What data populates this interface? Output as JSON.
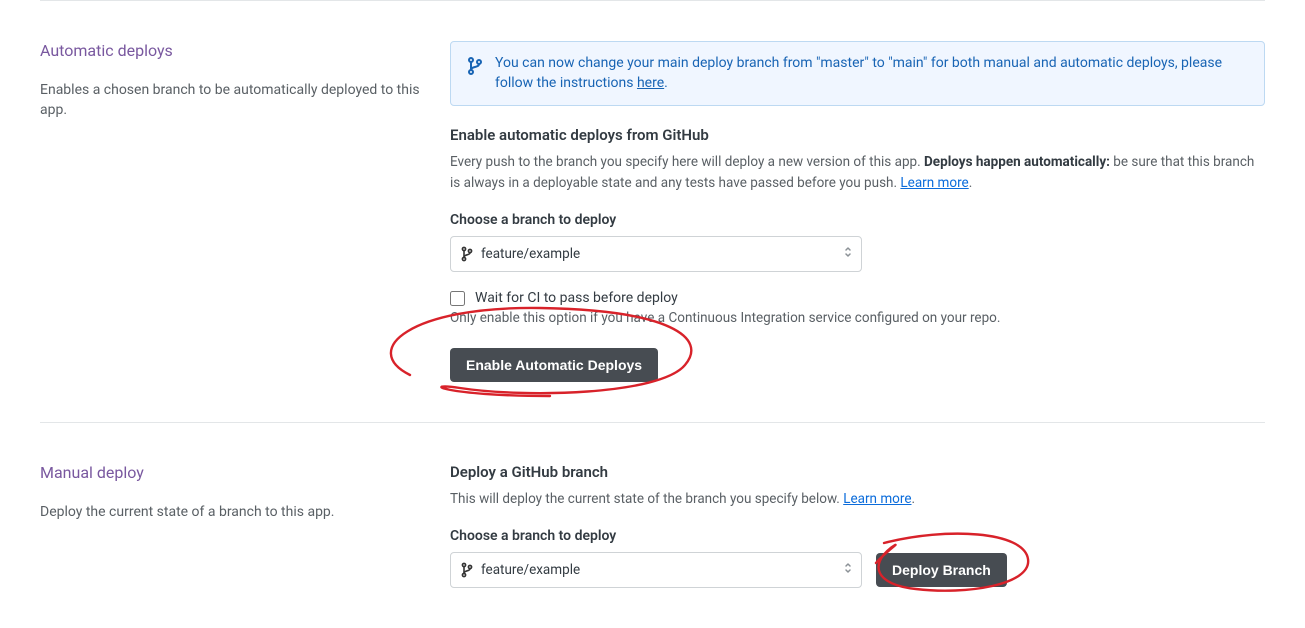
{
  "auto": {
    "title": "Automatic deploys",
    "desc": "Enables a chosen branch to be automatically deployed to this app.",
    "notice_text": "You can now change your main deploy branch from \"master\" to \"main\" for both manual and automatic deploys, please follow the instructions ",
    "notice_link": "here",
    "notice_tail": ".",
    "sub": "Enable automatic deploys from GitHub",
    "help_a": "Every push to the branch you specify here will deploy a new version of this app. ",
    "help_strong": "Deploys happen automatically:",
    "help_b": " be sure that this branch is always in a deployable state and any tests have passed before you push. ",
    "learn": "Learn more",
    "learn_tail": ".",
    "choose": "Choose a branch to deploy",
    "branch": "feature/example",
    "wait_ci": "Wait for CI to pass before deploy",
    "ci_hint": "Only enable this option if you have a Continuous Integration service configured on your repo.",
    "enable_btn": "Enable Automatic Deploys"
  },
  "manual": {
    "title": "Manual deploy",
    "desc": "Deploy the current state of a branch to this app.",
    "sub": "Deploy a GitHub branch",
    "help": "This will deploy the current state of the branch you specify below. ",
    "learn": "Learn more",
    "learn_tail": ".",
    "choose": "Choose a branch to deploy",
    "branch": "feature/example",
    "deploy_btn": "Deploy Branch"
  }
}
